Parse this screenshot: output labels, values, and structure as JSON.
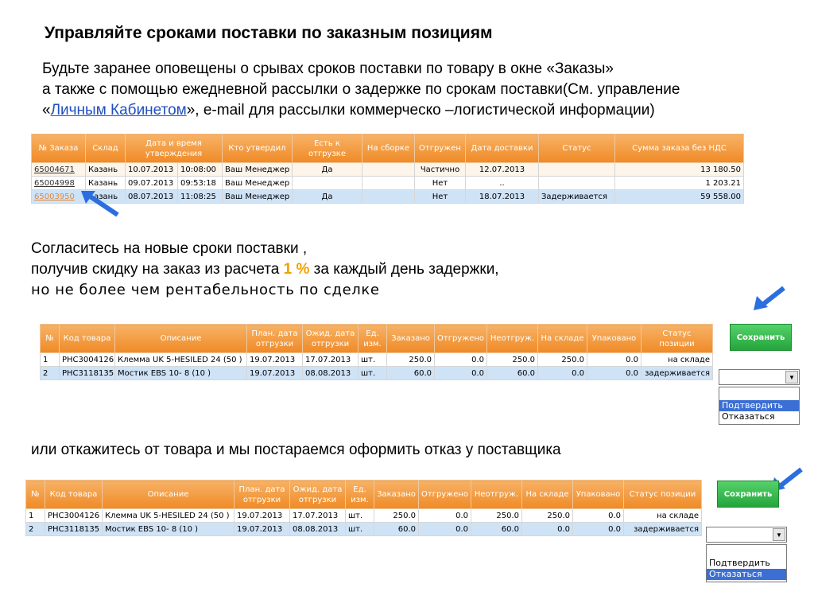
{
  "title": "Управляйте сроками поставки по заказным позициям",
  "intro": {
    "line1": "Будьте заранее оповещены о срывах сроков поставки по товару в окне «Заказы»",
    "line2": "а также с помощью ежедневной рассылки о задержке по срокам поставки(См. управление",
    "line3_pre": " «",
    "line3_link": "Личным Кабинетом",
    "line3_post": "», e-mail для рассылки коммерческо –логистической информации)"
  },
  "orders": {
    "headers": [
      "№ Заказа",
      "Склад",
      "Дата и время утверждения",
      "Кто утвердил",
      "Есть к отгрузке",
      "На сборке",
      "Отгружен",
      "Дата доставки",
      "Статус",
      "Сумма заказа без НДС"
    ],
    "rows": [
      {
        "num": "65004671",
        "sklad": "Казань",
        "date": "10.07.2013",
        "time": "10:08:00",
        "who": "Ваш Менеджер",
        "ready": "Да",
        "assembly": "",
        "shipped": "Частично",
        "delivery": "12.07.2013",
        "status": "",
        "sum": "13 180.50"
      },
      {
        "num": "65004998",
        "sklad": "Казань",
        "date": "09.07.2013",
        "time": "09:53:18",
        "who": "Ваш Менеджер",
        "ready": "",
        "assembly": "",
        "shipped": "Нет",
        "delivery": "..",
        "status": "",
        "sum": "1 203.21"
      },
      {
        "num": "65003950",
        "sklad": "Казань",
        "date": "08.07.2013",
        "time": "11:08:25",
        "who": "Ваш Менеджер",
        "ready": "Да",
        "assembly": "",
        "shipped": "Нет",
        "delivery": "18.07.2013",
        "status": "Задерживается",
        "sum": "59 558.00"
      }
    ]
  },
  "agree": {
    "line1": "Согласитесь на новые сроки поставки ,",
    "line2_pre": "получив скидку на заказ из расчета ",
    "line2_pct": "1 %",
    "line2_post": " за каждый день задержки,",
    "line3": "но не более чем рентабельность по сделке"
  },
  "items_headers": [
    "№",
    "Код товара",
    "Описание",
    "План. дата отгрузки",
    "Ожид. дата отгрузки",
    "Ед. изм.",
    "Заказано",
    "Отгружено",
    "Неотгруж.",
    "На складе",
    "Упаковано",
    "Статус позиции"
  ],
  "items": [
    {
      "n": "1",
      "code": "PHC3004126",
      "desc": "Клемма UK 5-HESILED 24 (50 )",
      "plan": "19.07.2013",
      "exp": "17.07.2013",
      "unit": "шт.",
      "ordered": "250.0",
      "shipped": "0.0",
      "notshipped": "250.0",
      "stock": "250.0",
      "packed": "0.0",
      "status": "на складе"
    },
    {
      "n": "2",
      "code": "PHC3118135",
      "desc": "Мостик EBS 10- 8 (10 )",
      "plan": "19.07.2013",
      "exp": "08.08.2013",
      "unit": "шт.",
      "ordered": "60.0",
      "shipped": "0.0",
      "notshipped": "60.0",
      "stock": "0.0",
      "packed": "0.0",
      "status": "задерживается"
    }
  ],
  "save_label": "Сохранить",
  "options": [
    "Подтвердить",
    "Отказаться"
  ],
  "refuse_text": "или откажитесь от товара и мы постараемся оформить отказ у поставщика",
  "colors": {
    "arrow": "#2a6ee0",
    "header": "#ef8a26",
    "save": "#24a53b",
    "highlight": "#3b6fd4"
  }
}
